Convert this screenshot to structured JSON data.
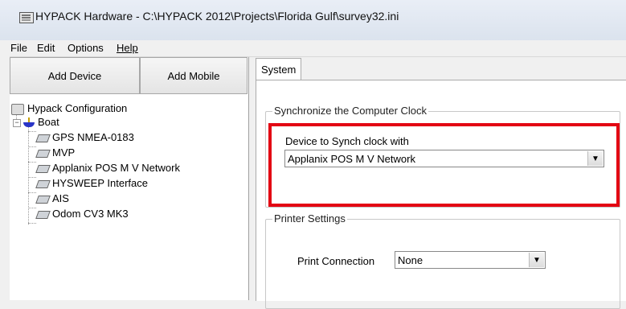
{
  "window": {
    "title": "HYPACK Hardware - C:\\HYPACK 2012\\Projects\\Florida Gulf\\survey32.ini"
  },
  "menu": {
    "items": [
      {
        "label": "File",
        "underline": false
      },
      {
        "label": "Edit",
        "underline": false
      },
      {
        "label": "Options",
        "underline": false
      },
      {
        "label": "Help",
        "underline": true
      }
    ]
  },
  "toolbar": {
    "add_device_label": "Add Device",
    "add_mobile_label": "Add Mobile"
  },
  "tree": {
    "root": "Hypack Configuration",
    "mobile": "Boat",
    "devices": [
      "GPS NMEA-0183",
      "MVP",
      "Applanix POS M V Network",
      "HYSWEEP Interface",
      "AIS",
      "Odom CV3 MK3"
    ]
  },
  "tabs": {
    "system_label": "System"
  },
  "sync_clock": {
    "group_title": "Synchronize the Computer Clock",
    "device_label": "Device to Synch clock with",
    "selected_device": "Applanix POS M V Network"
  },
  "printer": {
    "group_title": "Printer Settings",
    "connection_label": "Print Connection",
    "connection_value": "None"
  },
  "colors": {
    "highlight": "#e30613",
    "boat_icon": "#2a35c7"
  }
}
